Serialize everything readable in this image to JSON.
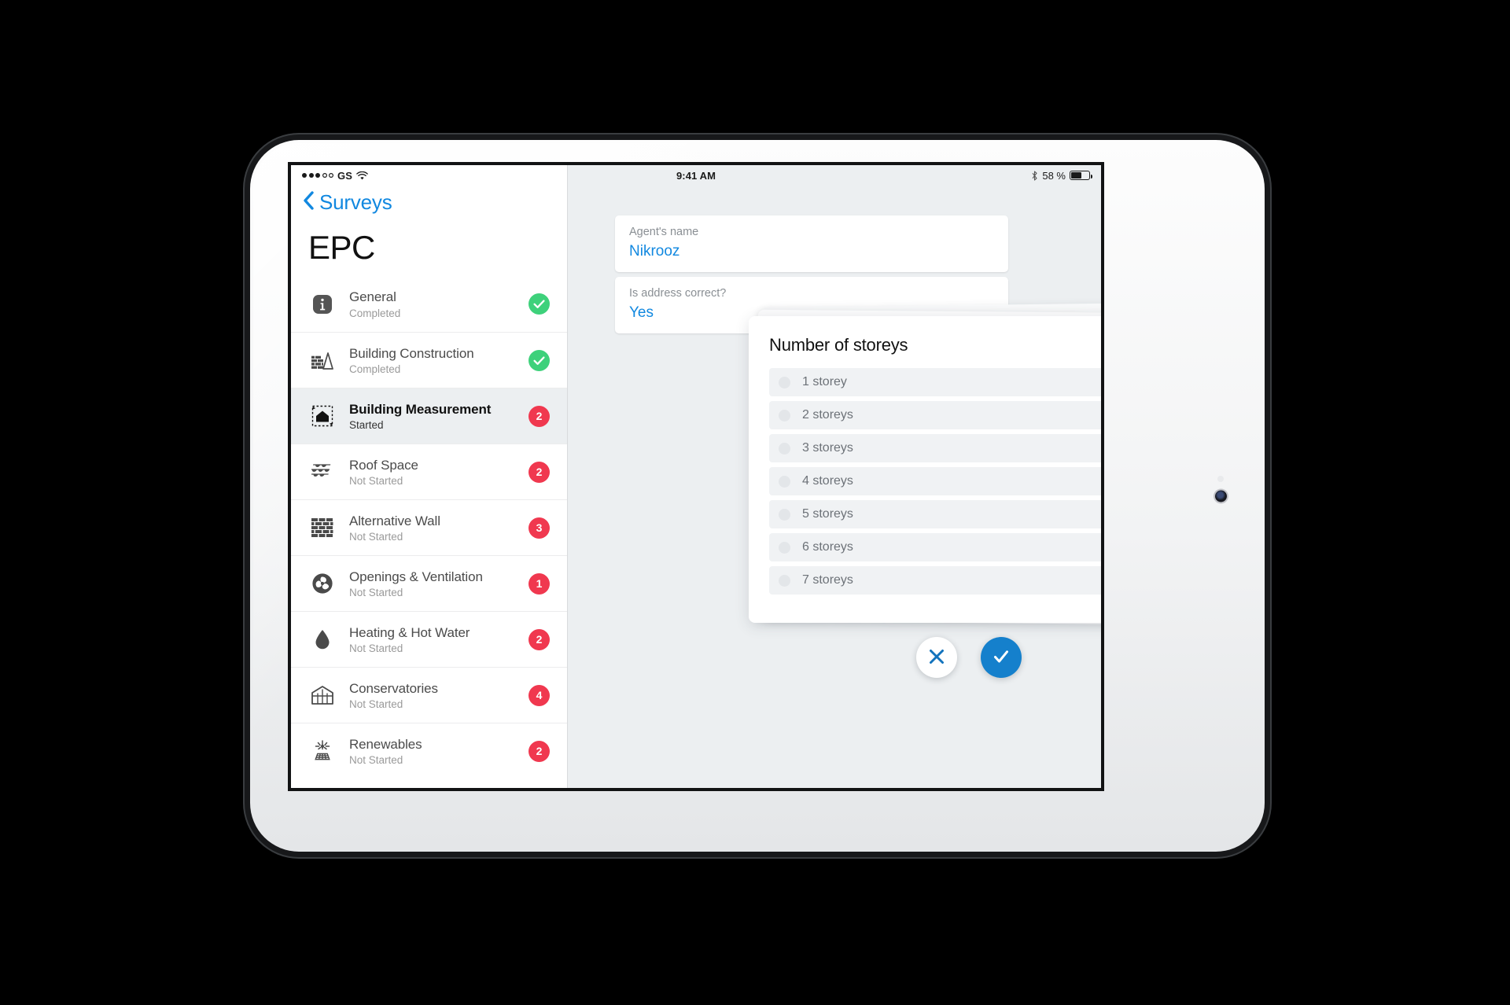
{
  "device": {
    "label": "ipad-landscape-white"
  },
  "statusbar": {
    "signal_dots_filled": 3,
    "signal_dots_empty": 2,
    "carrier": "GS",
    "wifi_icon": "wifi-icon",
    "time": "9:41 AM",
    "bluetooth_icon": "bluetooth-icon",
    "battery_text": "58 %",
    "battery_percent": 58
  },
  "sidebar": {
    "back_label": "Surveys",
    "back_icon": "chevron-left-icon",
    "title": "EPC",
    "items": [
      {
        "name": "General",
        "status": "Completed",
        "icon": "info-icon",
        "badge": "check",
        "badge_value": ""
      },
      {
        "name": "Building Construction",
        "status": "Completed",
        "icon": "bricks-icon",
        "badge": "check",
        "badge_value": ""
      },
      {
        "name": "Building Measurement",
        "status": "Started",
        "icon": "measure-house-icon",
        "badge": "count",
        "badge_value": "2",
        "selected": true
      },
      {
        "name": "Roof Space",
        "status": "Not Started",
        "icon": "roof-tiles-icon",
        "badge": "count",
        "badge_value": "2"
      },
      {
        "name": "Alternative Wall",
        "status": "Not Started",
        "icon": "brick-wall-icon",
        "badge": "count",
        "badge_value": "3"
      },
      {
        "name": "Openings & Ventilation",
        "status": "Not Started",
        "icon": "fan-icon",
        "badge": "count",
        "badge_value": "1"
      },
      {
        "name": "Heating & Hot Water",
        "status": "Not Started",
        "icon": "water-drop-icon",
        "badge": "count",
        "badge_value": "2"
      },
      {
        "name": "Conservatories",
        "status": "Not Started",
        "icon": "conservatory-icon",
        "badge": "count",
        "badge_value": "4"
      },
      {
        "name": "Renewables",
        "status": "Not Started",
        "icon": "solar-panel-icon",
        "badge": "count",
        "badge_value": "2"
      }
    ]
  },
  "main": {
    "fields": [
      {
        "label": "Agent's name",
        "value": "Nikrooz"
      },
      {
        "label": "Is address correct?",
        "value": "Yes"
      }
    ],
    "modal": {
      "title": "Number of storeys",
      "options": [
        {
          "label": "1 storey",
          "selected": false
        },
        {
          "label": "2 storeys",
          "selected": false
        },
        {
          "label": "3 storeys",
          "selected": false
        },
        {
          "label": "4 storeys",
          "selected": false
        },
        {
          "label": "5 storeys",
          "selected": false
        },
        {
          "label": "6 storeys",
          "selected": false
        },
        {
          "label": "7 storeys",
          "selected": false
        }
      ]
    },
    "actions": {
      "cancel_icon": "close-icon",
      "confirm_icon": "check-icon"
    }
  },
  "colors": {
    "accent_blue": "#1188e0",
    "badge_red": "#f0384f",
    "badge_green": "#3ed17b",
    "panel_bg": "#eceff1",
    "confirm_blue": "#1580cc"
  }
}
